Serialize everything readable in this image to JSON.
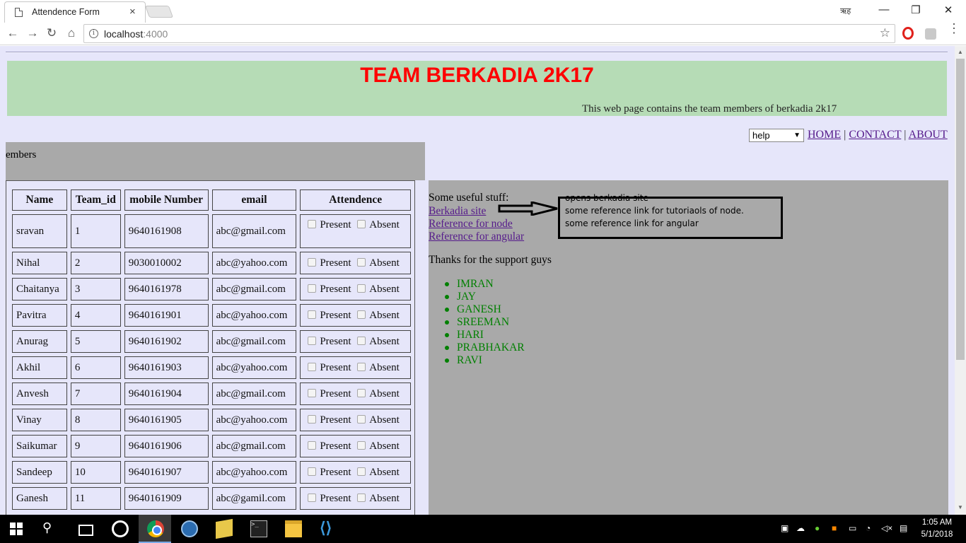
{
  "browser": {
    "tab_title": "Attendence Form",
    "tab_close": "×",
    "profile": "ऋह",
    "url_host": "localhost",
    "url_port": ":4000",
    "minimize": "—",
    "maximize": "❐",
    "close": "✕",
    "back": "←",
    "forward": "→",
    "reload": "↻",
    "home": "⌂",
    "star": "☆",
    "menu": "⋮"
  },
  "page": {
    "title": "TEAM BERKADIA 2K17",
    "subtitle": "This web page contains the team members of berkadia 2k17",
    "help_select": "help",
    "nav": {
      "home": "HOME",
      "contact": "CONTACT",
      "about": "ABOUT",
      "sep": "|"
    },
    "members_label": "embers",
    "table": {
      "headers": [
        "Name",
        "Team_id",
        "mobile Number",
        "email",
        "Attendence"
      ],
      "present": "Present",
      "absent": "Absent",
      "rows": [
        [
          "sravan",
          "1",
          "9640161908",
          "abc@gmail.com"
        ],
        [
          "Nihal",
          "2",
          "9030010002",
          "abc@yahoo.com"
        ],
        [
          "Chaitanya",
          "3",
          "9640161978",
          "abc@gmail.com"
        ],
        [
          "Pavitra",
          "4",
          "9640161901",
          "abc@yahoo.com"
        ],
        [
          "Anurag",
          "5",
          "9640161902",
          "abc@gmail.com"
        ],
        [
          "Akhil",
          "6",
          "9640161903",
          "abc@yahoo.com"
        ],
        [
          "Anvesh",
          "7",
          "9640161904",
          "abc@gmail.com"
        ],
        [
          "Vinay",
          "8",
          "9640161905",
          "abc@yahoo.com"
        ],
        [
          "Saikumar",
          "9",
          "9640161906",
          "abc@gmail.com"
        ],
        [
          "Sandeep",
          "10",
          "9640161907",
          "abc@yahoo.com"
        ],
        [
          "Ganesh",
          "11",
          "9640161909",
          "abc@gamil.com"
        ]
      ]
    },
    "useful_heading": "Some useful stuff:",
    "links": [
      "Berkadia site",
      "Reference for node",
      "Reference for angular"
    ],
    "annotations": [
      "opens berkadia site",
      "some reference link for tutoriaols of node.",
      "some reference link for angular"
    ],
    "thanks": "Thanks for the support guys",
    "supporters": [
      "IMRAN",
      "JAY",
      "GANESH",
      "SREEMAN",
      "HARI",
      "PRABHAKAR",
      "RAVI"
    ]
  },
  "taskbar": {
    "time": "1:05 AM",
    "date": "5/1/2018"
  }
}
